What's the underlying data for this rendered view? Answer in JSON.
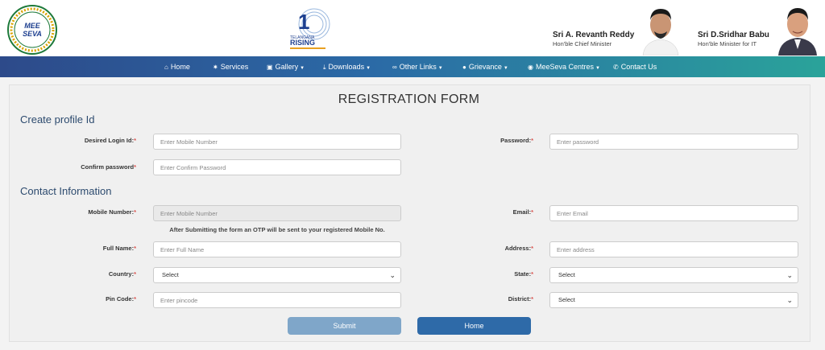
{
  "header": {
    "logo_left_text": "MEE SEVA",
    "logo_center_text": "TELANGANA RISING",
    "leaders": [
      {
        "name": "Sri A. Revanth Reddy",
        "role": "Hon'ble Chief Minister"
      },
      {
        "name": "Sri D.Sridhar Babu",
        "role": "Hon'ble Minister for IT"
      }
    ]
  },
  "nav": {
    "items": [
      {
        "label": "Home",
        "icon": "home-icon"
      },
      {
        "label": "Services",
        "icon": "gear-icon"
      },
      {
        "label": "Gallery",
        "icon": "image-icon"
      },
      {
        "label": "Downloads",
        "icon": "download-icon"
      },
      {
        "label": "Other Links",
        "icon": "link-icon"
      },
      {
        "label": "Grievance",
        "icon": "chat-icon"
      },
      {
        "label": "MeeSeva Centres",
        "icon": "map-marker-icon"
      },
      {
        "label": "Contact Us",
        "icon": "phone-icon"
      }
    ]
  },
  "form": {
    "title": "REGISTRATION FORM",
    "profile_section": "Create profile Id",
    "contact_section": "Contact Information",
    "fields": {
      "login_id": {
        "label": "Desired Login Id:",
        "placeholder": "Enter Mobile Number"
      },
      "password": {
        "label": "Password:",
        "placeholder": "Enter password"
      },
      "confirm_password": {
        "label": "Confirm password",
        "placeholder": "Enter Confirm Password"
      },
      "mobile": {
        "label": "Mobile Number:",
        "placeholder": "Enter Mobile Number"
      },
      "email": {
        "label": "Email:",
        "placeholder": "Enter Email"
      },
      "full_name": {
        "label": "Full Name:",
        "placeholder": "Enter Full Name"
      },
      "address": {
        "label": "Address:",
        "placeholder": "Enter address"
      },
      "country": {
        "label": "Country:",
        "value": "Select"
      },
      "state": {
        "label": "State:",
        "value": "Select"
      },
      "pincode": {
        "label": "Pin Code:",
        "placeholder": "Enter pincode"
      },
      "district": {
        "label": "District:",
        "value": "Select"
      }
    },
    "required_mark": "*",
    "otp_note": "After Submitting the form an OTP will be sent to your registered Mobile No.",
    "submit_label": "Submit",
    "home_label": "Home"
  },
  "colors": {
    "nav_start": "#2d4a8a",
    "nav_end": "#2aa39a",
    "section_title": "#2c4a6e",
    "required": "#d9534f",
    "submit_bg": "#7fa6c9",
    "home_bg": "#2e6aa8"
  }
}
